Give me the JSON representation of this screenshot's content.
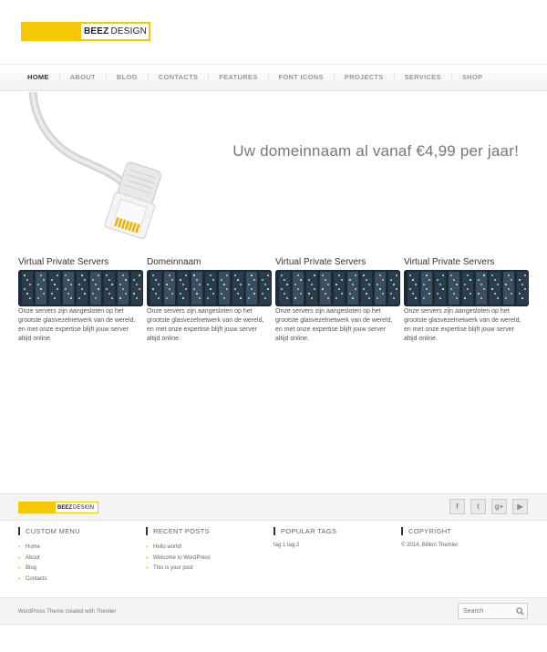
{
  "header": {
    "logo_bold": "BEEZ",
    "logo_rest": "DESIGN"
  },
  "nav": {
    "items": [
      "HOME",
      "ABOUT",
      "BLOG",
      "CONTACTS",
      "FEATURES",
      "FONT ICONS",
      "PROJECTS",
      "SERVICES",
      "SHOP"
    ]
  },
  "hero": {
    "tagline": "Uw domeinnaam al vanaf €4,99 per jaar!"
  },
  "columns": [
    {
      "title": "Virtual Private Servers",
      "text": "Onze servers zijn aangesloten op het grootste glasvezelnetwerk van de wereld, en met onze expertise blijft jouw server altijd online."
    },
    {
      "title": "Domeinnaam",
      "text": "Onze servers zijn aangesloten op het grootste glasvezelnetwerk van de wereld, en met onze expertise blijft jouw server altijd online."
    },
    {
      "title": "Virtual Private Servers",
      "text": "Onze servers zijn aangesloten op het grootste glasvezelnetwerk van de wereld, en met onze expertise blijft jouw server altijd online."
    },
    {
      "title": "Virtual Private Servers",
      "text": "Onze servers zijn aangesloten op het grootste glasvezelnetwerk van de wereld, en met onze expertise blijft jouw server altijd online."
    }
  ],
  "footer": {
    "logo_bold": "BEEZ",
    "logo_rest": "DESIGN",
    "social": [
      {
        "icon": "facebook-icon",
        "glyph": "f"
      },
      {
        "icon": "twitter-icon",
        "glyph": "t"
      },
      {
        "icon": "google-plus-icon",
        "glyph": "g+"
      },
      {
        "icon": "youtube-icon",
        "glyph": "▶"
      }
    ],
    "widgets": {
      "custom_menu": {
        "title": "CUSTOM MENU",
        "items": [
          "Home",
          "About",
          "Blog",
          "Contacts"
        ]
      },
      "recent_posts": {
        "title": "RECENT POSTS",
        "items": [
          "Hello world!",
          "Welcome to WordPress",
          "This is your post"
        ]
      },
      "popular_tags": {
        "title": "POPULAR TAGS",
        "text": "tag 1 tag 2"
      },
      "copyright": {
        "title": "COPYRIGHT",
        "text": "© 2014, Billion Themler"
      }
    },
    "credit": "WordPress Theme created with Themler",
    "search_placeholder": "Search"
  },
  "colors": {
    "accent": "#f5c800",
    "nav_text": "#999999",
    "nav_active": "#333333"
  }
}
